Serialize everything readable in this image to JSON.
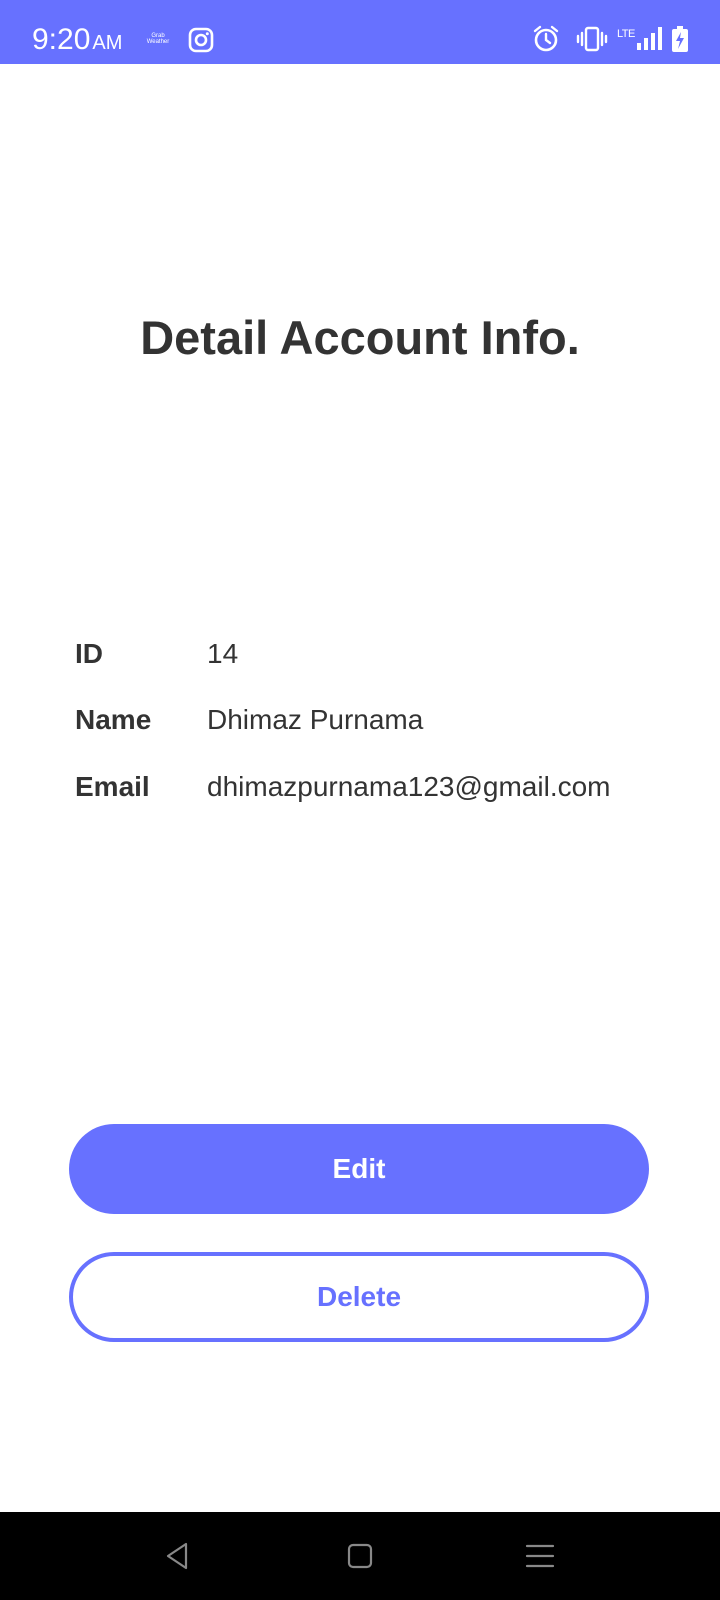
{
  "status_bar": {
    "time": "9:20",
    "ampm": "AM",
    "weather_text": "Grab Weather",
    "network": "LTE",
    "background": "#6771ff",
    "icons": [
      "weather-widget-icon",
      "instagram-icon",
      "alarm-icon",
      "vibrate-icon",
      "signal-icon",
      "battery-charging-icon"
    ]
  },
  "page": {
    "title": "Detail Account Info."
  },
  "account": {
    "id_label": "ID",
    "id_value": "14",
    "name_label": "Name",
    "name_value": "Dhimaz Purnama",
    "email_label": "Email",
    "email_value": "dhimazpurnama123@gmail.com"
  },
  "actions": {
    "edit_label": "Edit",
    "delete_label": "Delete",
    "accent_color": "#6771ff"
  },
  "nav_bar": {
    "icons": [
      "back-icon",
      "home-icon",
      "recents-menu-icon"
    ]
  }
}
